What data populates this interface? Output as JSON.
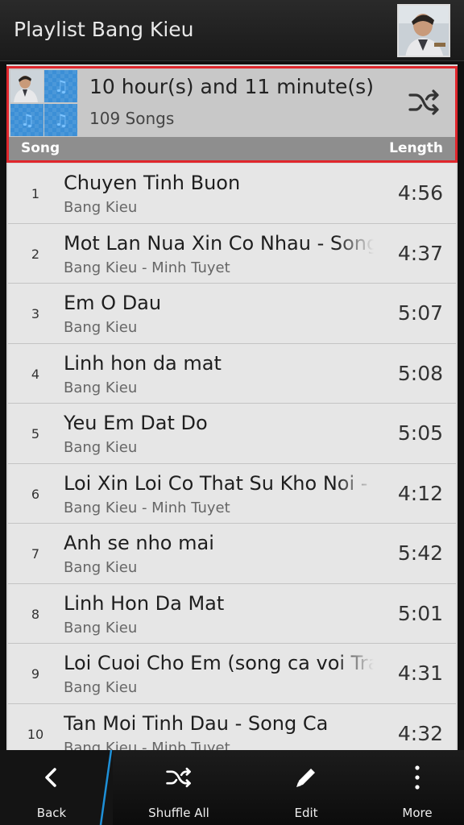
{
  "title": "Playlist Bang Kieu",
  "playlist": {
    "duration": "10 hour(s) and 11 minute(s)",
    "count": "109 Songs",
    "col_song": "Song",
    "col_length": "Length"
  },
  "songs": [
    {
      "num": "1",
      "title": "Chuyen Tinh Buon",
      "artist": "Bang Kieu",
      "length": "4:56"
    },
    {
      "num": "2",
      "title": "Mot Lan Nua Xin Co Nhau - Song",
      "artist": "Bang Kieu - Minh Tuyet",
      "length": "4:37"
    },
    {
      "num": "3",
      "title": "Em O Dau",
      "artist": "Bang Kieu",
      "length": "5:07"
    },
    {
      "num": "4",
      "title": "Linh hon da mat",
      "artist": "Bang Kieu",
      "length": "5:08"
    },
    {
      "num": "5",
      "title": "Yeu Em Dat Do",
      "artist": "Bang Kieu",
      "length": "5:05"
    },
    {
      "num": "6",
      "title": "Loi Xin Loi Co That Su Kho Noi -",
      "artist": "Bang Kieu - Minh Tuyet",
      "length": "4:12"
    },
    {
      "num": "7",
      "title": "Anh se nho mai",
      "artist": "Bang Kieu",
      "length": "5:42"
    },
    {
      "num": "8",
      "title": "Linh Hon Da Mat",
      "artist": "Bang Kieu",
      "length": "5:01"
    },
    {
      "num": "9",
      "title": "Loi Cuoi Cho Em (song ca voi Tra",
      "artist": "Bang Kieu",
      "length": "4:31"
    },
    {
      "num": "10",
      "title": "Tan Moi Tinh Dau - Song Ca",
      "artist": "Bang Kieu - Minh Tuyet",
      "length": "4:32"
    }
  ],
  "actions": {
    "back": "Back",
    "shuffle_all": "Shuffle All",
    "edit": "Edit",
    "more": "More"
  },
  "colors": {
    "selection_border": "#e0262c",
    "accent_divider": "#1e90d8",
    "album_tile": "#3c8fd6"
  }
}
